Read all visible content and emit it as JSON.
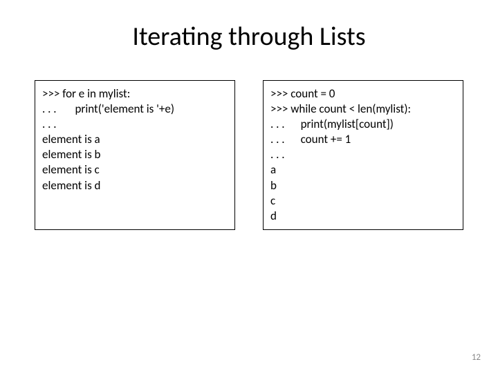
{
  "title": "Iterating through Lists",
  "left_box": {
    "lines": [
      ">>> for e in mylist:",
      ". . .       print('element is '+e)",
      ". . .",
      "element is a",
      "element is b",
      "element is c",
      "element is d"
    ]
  },
  "right_box": {
    "lines": [
      ">>> count = 0",
      ">>> while count < len(mylist):",
      ". . .      print(mylist[count])",
      ". . .      count += 1",
      ". . .",
      "a",
      "b",
      "c",
      "d"
    ]
  },
  "page_number": "12"
}
